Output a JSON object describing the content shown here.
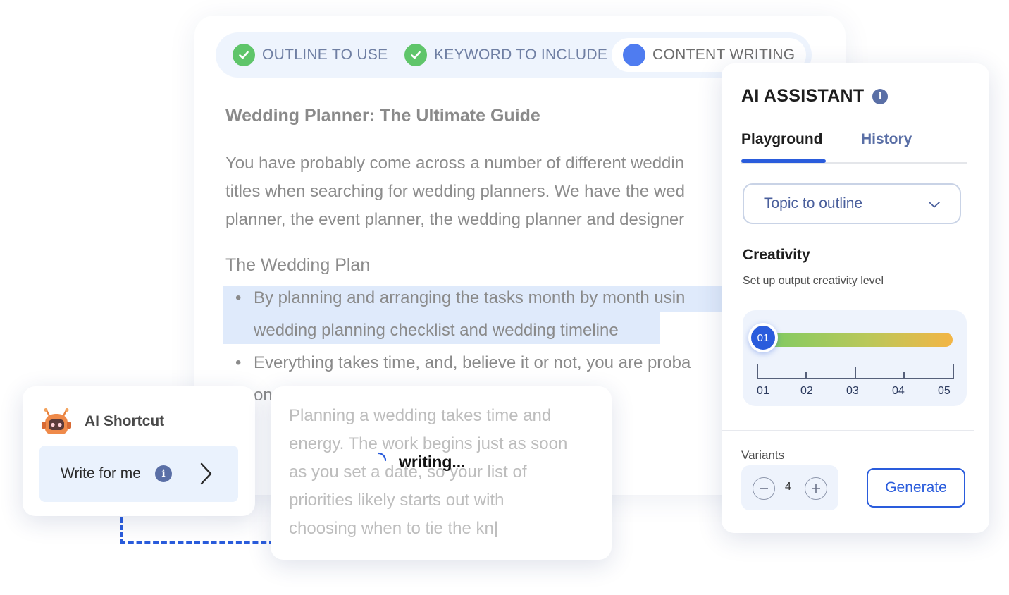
{
  "steps": [
    {
      "label": "OUTLINE TO USE",
      "state": "done"
    },
    {
      "label": "KEYWORD TO INCLUDE",
      "state": "done"
    },
    {
      "label": "CONTENT WRITING",
      "state": "active"
    }
  ],
  "document": {
    "title": "Wedding Planner: The Ultimate Guide",
    "paragraph_lines": [
      "You have probably come across a number of different weddin",
      "titles when searching for wedding planners. We have the wed",
      "planner, the event planner, the wedding planner and designer"
    ],
    "subheading": "The Wedding Plan",
    "bullets": [
      {
        "line1": "By planning and arranging the tasks month by month usin",
        "line2": "wedding planning checklist and wedding timeline"
      },
      {
        "line1": "Everything takes time, and, believe it or not, you are proba",
        "line2": "on"
      }
    ]
  },
  "assistant": {
    "title": "AI ASSISTANT",
    "tabs": {
      "playground": "Playground",
      "history": "History"
    },
    "select_value": "Topic to outline",
    "creativity_label": "Creativity",
    "creativity_sub": "Set up output creativity level",
    "slider_value": "01",
    "tick_labels": [
      "01",
      "02",
      "03",
      "04",
      "05"
    ],
    "variants_label": "Variants",
    "variants_count": "4",
    "generate_label": "Generate",
    "colors": {
      "accent": "#2a5cdc",
      "gradient_start": "#7ccb62",
      "gradient_end": "#f3b545"
    }
  },
  "shortcut": {
    "title": "AI Shortcut",
    "button_label": "Write for me"
  },
  "popup": {
    "lines": [
      "Planning a wedding takes time and",
      "energy. The work begins just as soon",
      "as you set a date, so your list of",
      "priorities likely starts out with",
      "choosing when to tie the kn|"
    ],
    "status": "writing..."
  }
}
